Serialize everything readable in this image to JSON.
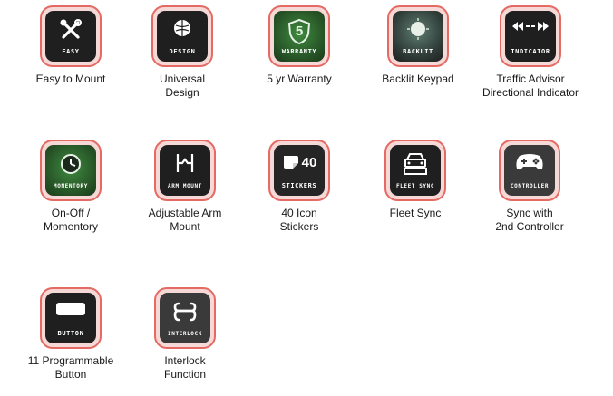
{
  "features": [
    {
      "icon": "tools-icon",
      "badge": "EASY",
      "caption": [
        "Easy to Mount"
      ]
    },
    {
      "icon": "globe-icon",
      "badge": "DESIGN",
      "caption": [
        "Universal",
        "Design"
      ]
    },
    {
      "icon": "shield-5-icon",
      "badge": "WARRANTY",
      "badge_value": "5",
      "caption": [
        "5 yr Warranty"
      ]
    },
    {
      "icon": "backlit-keypad-icon",
      "badge": "BACKLIT",
      "caption": [
        "Backlit Keypad"
      ]
    },
    {
      "icon": "arrows-icon",
      "badge": "INDICATOR",
      "caption": [
        "Traffic Advisor",
        "Directional Indicator"
      ]
    },
    {
      "icon": "momentary-icon",
      "badge": "MOMENTORY",
      "caption": [
        "On-Off /",
        "Momentory"
      ]
    },
    {
      "icon": "adjustable-arm-icon",
      "badge": "ARM MOUNT",
      "caption": [
        "Adjustable Arm",
        "Mount"
      ]
    },
    {
      "icon": "stickers-icon",
      "badge": "STICKERS",
      "badge_value": "40",
      "caption": [
        "40 Icon",
        "Stickers"
      ]
    },
    {
      "icon": "fleet-sync-icon",
      "badge": "FLEET SYNC",
      "caption": [
        "Fleet Sync"
      ]
    },
    {
      "icon": "controller-icon",
      "badge": "CONTROLLER",
      "caption": [
        "Sync with",
        "2nd Controller"
      ]
    },
    {
      "icon": "button-icon",
      "badge": "BUTTON",
      "caption": [
        "11 Programmable",
        "Button"
      ]
    },
    {
      "icon": "interlock-icon",
      "badge": "INTERLOCK",
      "caption": [
        "Interlock",
        "Function"
      ]
    }
  ]
}
